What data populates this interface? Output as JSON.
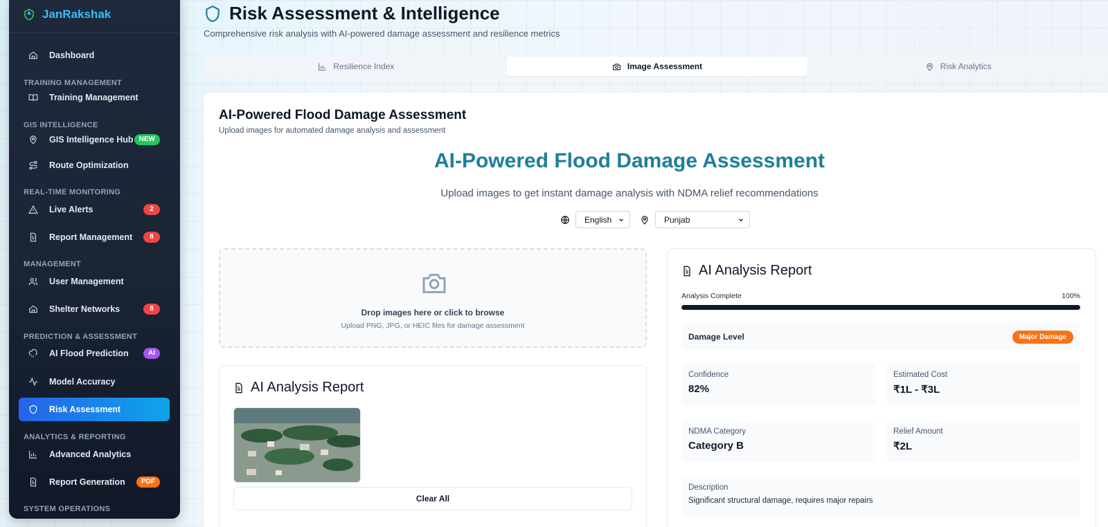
{
  "app": {
    "name": "JanRakshak"
  },
  "sidebar": {
    "sections": [
      {
        "label": "Training Management"
      },
      {
        "label": "GIS Intelligence"
      },
      {
        "label": "Real-time Monitoring"
      },
      {
        "label": "Management"
      },
      {
        "label": "Prediction & Assessment"
      },
      {
        "label": "Analytics & Reporting"
      },
      {
        "label": "System Operations"
      }
    ],
    "items": [
      {
        "label": "Dashboard",
        "icon": "home-icon"
      },
      {
        "label": "Training Management",
        "icon": "book-icon"
      },
      {
        "label": "GIS Intelligence Hub",
        "icon": "map-pin-icon",
        "badge": "NEW"
      },
      {
        "label": "Route Optimization",
        "icon": "route-icon"
      },
      {
        "label": "Live Alerts",
        "icon": "alert-triangle-icon",
        "badge": "2"
      },
      {
        "label": "Report Management",
        "icon": "file-text-icon",
        "badge": "8"
      },
      {
        "label": "User Management",
        "icon": "users-icon"
      },
      {
        "label": "Shelter Networks",
        "icon": "home-icon",
        "badge": "8"
      },
      {
        "label": "AI Flood Prediction",
        "icon": "cloud-rain-icon",
        "badge": "AI"
      },
      {
        "label": "Model Accuracy",
        "icon": "activity-icon"
      },
      {
        "label": "Risk Assessment",
        "icon": "shield-icon",
        "active": true
      },
      {
        "label": "Advanced Analytics",
        "icon": "bar-chart-icon"
      },
      {
        "label": "Report Generation",
        "icon": "file-text-icon",
        "badge": "PDF"
      }
    ]
  },
  "header": {
    "title": "Risk Assessment & Intelligence",
    "subtitle": "Comprehensive risk analysis with AI-powered damage assessment and resilience metrics"
  },
  "tabs": [
    {
      "label": "Resilience Index",
      "icon": "bar-chart-icon"
    },
    {
      "label": "Image Assessment",
      "icon": "camera-icon",
      "active": true
    },
    {
      "label": "Risk Analytics",
      "icon": "map-pin-icon"
    }
  ],
  "card": {
    "title": "AI-Powered Flood Damage Assessment",
    "subtitle": "Upload images for automated damage analysis and assessment"
  },
  "hero": {
    "title": "AI-Powered Flood Damage Assessment",
    "subtitle": "Upload images to get instant damage analysis with NDMA relief recommendations"
  },
  "selectors": {
    "language": "English",
    "region": "Punjab"
  },
  "upload": {
    "main": "Drop images here or click to browse",
    "hint": "Upload PNG, JPG, or HEIC files for damage assessment"
  },
  "report_left": {
    "title": "AI Analysis Report",
    "clear_label": "Clear All"
  },
  "report_right": {
    "title": "AI Analysis Report",
    "progress_label": "Analysis Complete",
    "progress_value": "100%",
    "progress_fraction": 1.0,
    "damage_label": "Damage Level",
    "damage_badge": "Major Damage",
    "stats": [
      {
        "label": "Confidence",
        "value": "82%"
      },
      {
        "label": "Estimated Cost",
        "value": "₹1L - ₹3L"
      },
      {
        "label": "NDMA Category",
        "value": "Category B"
      },
      {
        "label": "Relief Amount",
        "value": "₹2L"
      }
    ],
    "description_label": "Description",
    "description": "Significant structural damage, requires major repairs"
  },
  "colors": {
    "accent": "#1e7f99",
    "active_nav": "#2563eb",
    "badge_red": "#ef4444",
    "badge_green": "#22c55e",
    "badge_purple": "#a855f7",
    "badge_orange": "#f97316"
  }
}
